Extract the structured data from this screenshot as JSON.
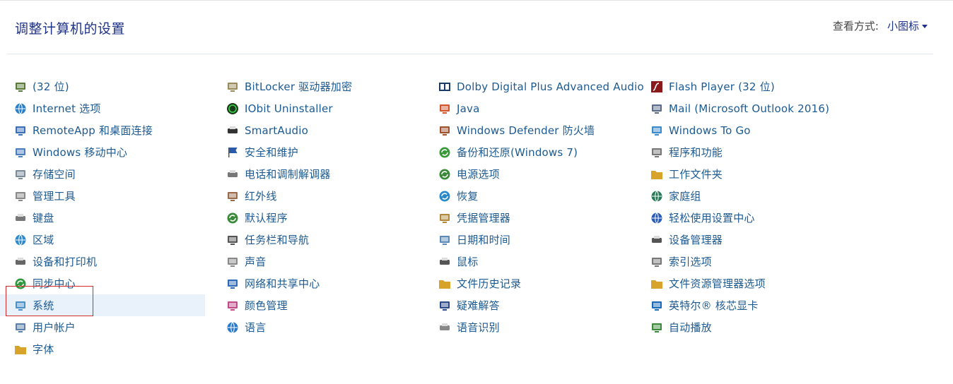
{
  "header": {
    "title": "调整计算机的设置",
    "view_by_label": "查看方式:",
    "view_by_value": "小图标"
  },
  "columns": [
    [
      {
        "label": "(32 位)",
        "icon": "gear-people-icon",
        "color": "#5a7a3a"
      },
      {
        "label": "Internet 选项",
        "icon": "globe-icon",
        "color": "#2a7fc9"
      },
      {
        "label": "RemoteApp 和桌面连接",
        "icon": "remote-desktop-icon",
        "color": "#3a6fb8"
      },
      {
        "label": "Windows 移动中心",
        "icon": "mobility-center-icon",
        "color": "#4b7ec1"
      },
      {
        "label": "存储空间",
        "icon": "storage-icon",
        "color": "#7b8b9a"
      },
      {
        "label": "管理工具",
        "icon": "admin-tools-icon",
        "color": "#8a8a8a"
      },
      {
        "label": "键盘",
        "icon": "keyboard-icon",
        "color": "#777777"
      },
      {
        "label": "区域",
        "icon": "region-globe-icon",
        "color": "#2f8ac9"
      },
      {
        "label": "设备和打印机",
        "icon": "printer-icon",
        "color": "#666666"
      },
      {
        "label": "同步中心",
        "icon": "sync-icon",
        "color": "#2f9a3f"
      },
      {
        "label": "系统",
        "icon": "system-computer-icon",
        "color": "#4a90c8",
        "selected": true
      },
      {
        "label": "用户帐户",
        "icon": "user-accounts-icon",
        "color": "#5b7fa8"
      },
      {
        "label": "字体",
        "icon": "fonts-icon",
        "color": "#d8a32a"
      }
    ],
    [
      {
        "label": "BitLocker 驱动器加密",
        "icon": "bitlocker-key-icon",
        "color": "#9a8a5a"
      },
      {
        "label": "IObit Uninstaller",
        "icon": "iobit-icon",
        "color": "#1a3a1a"
      },
      {
        "label": "SmartAudio",
        "icon": "headphones-icon",
        "color": "#333333"
      },
      {
        "label": "安全和维护",
        "icon": "flag-icon",
        "color": "#2a5aa8"
      },
      {
        "label": "电话和调制解调器",
        "icon": "phone-modem-icon",
        "color": "#777777"
      },
      {
        "label": "红外线",
        "icon": "infrared-icon",
        "color": "#9a6a4a"
      },
      {
        "label": "默认程序",
        "icon": "default-programs-icon",
        "color": "#3a8a3a"
      },
      {
        "label": "任务栏和导航",
        "icon": "taskbar-icon",
        "color": "#555555"
      },
      {
        "label": "声音",
        "icon": "sound-icon",
        "color": "#888888"
      },
      {
        "label": "网络和共享中心",
        "icon": "network-icon",
        "color": "#2a6ab8"
      },
      {
        "label": "颜色管理",
        "icon": "color-management-icon",
        "color": "#c04a8a"
      },
      {
        "label": "语言",
        "icon": "language-icon",
        "color": "#2a7ac9"
      }
    ],
    [
      {
        "label": "Dolby Digital Plus Advanced Audio",
        "icon": "dolby-icon",
        "color": "#1a3a6a"
      },
      {
        "label": "Java",
        "icon": "java-icon",
        "color": "#d0562a"
      },
      {
        "label": "Windows Defender 防火墙",
        "icon": "firewall-icon",
        "color": "#a0522d"
      },
      {
        "label": "备份和还原(Windows 7)",
        "icon": "backup-icon",
        "color": "#3a9a3a"
      },
      {
        "label": "电源选项",
        "icon": "power-options-icon",
        "color": "#3a8a3a"
      },
      {
        "label": "恢复",
        "icon": "recovery-icon",
        "color": "#2a8ac9"
      },
      {
        "label": "凭据管理器",
        "icon": "credential-manager-icon",
        "color": "#b08a3a"
      },
      {
        "label": "日期和时间",
        "icon": "date-time-icon",
        "color": "#5a8ab8"
      },
      {
        "label": "鼠标",
        "icon": "mouse-icon",
        "color": "#555555"
      },
      {
        "label": "文件历史记录",
        "icon": "file-history-icon",
        "color": "#d8a32a"
      },
      {
        "label": "疑难解答",
        "icon": "troubleshoot-icon",
        "color": "#2a4a8a"
      },
      {
        "label": "语音识别",
        "icon": "microphone-icon",
        "color": "#888888"
      }
    ],
    [
      {
        "label": "Flash Player (32 位)",
        "icon": "flash-icon",
        "color": "#8a1a1a"
      },
      {
        "label": "Mail (Microsoft Outlook 2016)",
        "icon": "mail-icon",
        "color": "#5a6a8a"
      },
      {
        "label": "Windows To Go",
        "icon": "windows-to-go-icon",
        "color": "#3a8ac9"
      },
      {
        "label": "程序和功能",
        "icon": "programs-features-icon",
        "color": "#777777"
      },
      {
        "label": "工作文件夹",
        "icon": "work-folders-icon",
        "color": "#d8a32a"
      },
      {
        "label": "家庭组",
        "icon": "homegroup-icon",
        "color": "#2a7a5a"
      },
      {
        "label": "轻松使用设置中心",
        "icon": "ease-of-access-icon",
        "color": "#2a5ab8"
      },
      {
        "label": "设备管理器",
        "icon": "device-manager-icon",
        "color": "#555555"
      },
      {
        "label": "索引选项",
        "icon": "indexing-icon",
        "color": "#777777"
      },
      {
        "label": "文件资源管理器选项",
        "icon": "folder-options-icon",
        "color": "#d8a32a"
      },
      {
        "label": "英特尔® 核芯显卡",
        "icon": "intel-graphics-icon",
        "color": "#1a6ab8"
      },
      {
        "label": "自动播放",
        "icon": "autoplay-icon",
        "color": "#3a8a3a"
      }
    ]
  ]
}
